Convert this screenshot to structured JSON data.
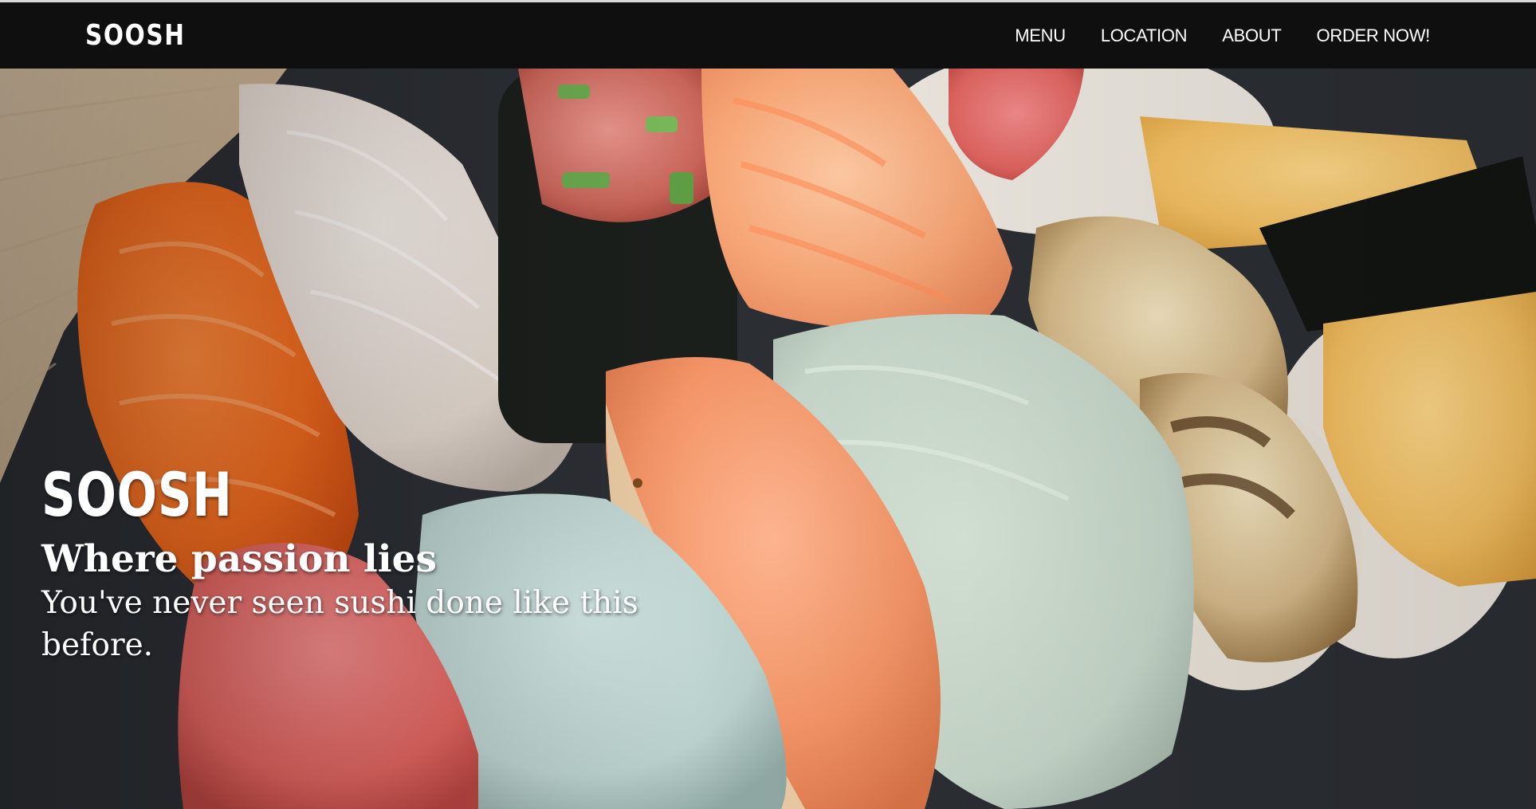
{
  "nav": {
    "brand": "SOOSH",
    "links": [
      {
        "label": "MENU"
      },
      {
        "label": "LOCATION"
      },
      {
        "label": "ABOUT"
      },
      {
        "label": "ORDER NOW!"
      }
    ]
  },
  "hero": {
    "title": "SOOSH",
    "tagline": "Where passion lies",
    "subtitle": "You've never seen sushi done like this before."
  },
  "colors": {
    "nav_background": "#0f0f0f",
    "nav_text": "#ffffff",
    "hero_text": "#ffffff"
  }
}
